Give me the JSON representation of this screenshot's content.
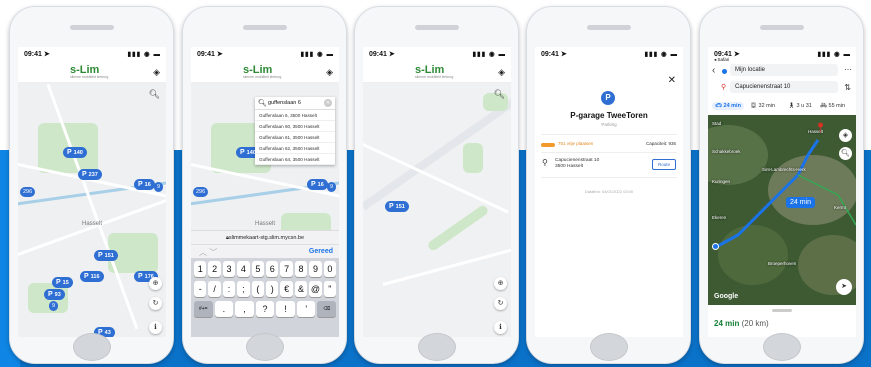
{
  "time": "09:41",
  "brand": {
    "logo": "s-Lim",
    "tagline": "slimme mobiliteit limburg",
    "accent": "#2f6fd3",
    "green": "#2d8a34",
    "blue_bg": "#0b72c9"
  },
  "screen1": {
    "map_label": "Hasselt",
    "pins": [
      "140",
      "237",
      "16",
      "151",
      "116",
      "176",
      "15",
      "93",
      "43"
    ],
    "cluster_labels": [
      "296",
      "9",
      "9"
    ]
  },
  "screen2": {
    "search_value": "guffenslaan 6",
    "suggestions": [
      "Guffenslaan 6, 3500 Hasselt",
      "Guffenslaan 60, 3500 Hasselt",
      "Guffenslaan 61, 3500 Hasselt",
      "Guffenslaan 62, 3500 Hasselt",
      "Guffenslaan 64, 3500 Hasselt"
    ],
    "map_label": "Hasselt",
    "pins": [
      "140",
      "16",
      "9"
    ],
    "cluster_labels": [
      "296"
    ],
    "url": "slimmekaart-stg.slim.mycsn.be",
    "done": "Gereed",
    "keys_row1": [
      "1",
      "2",
      "3",
      "4",
      "5",
      "6",
      "7",
      "8",
      "9",
      "0"
    ],
    "keys_row2": [
      "-",
      "/",
      ":",
      ";",
      "(",
      ")",
      "€",
      "&",
      "@",
      "\""
    ],
    "keys_row3": [
      "#+=",
      ".",
      ",",
      "?",
      "!",
      "'",
      "⌫"
    ]
  },
  "screen3": {
    "pin": "151"
  },
  "screen4": {
    "title": "P-garage TweeToren",
    "subtitle": "Parking",
    "free": "751 vrije plaatsen",
    "capacity": "Capaciteit: 936",
    "address_line1": "Capucienenstraat 10",
    "address_line2": "3500 Hasselt",
    "route_button": "Route",
    "updated": "Datafirst: 04/01/2022 03:00"
  },
  "screen5": {
    "back_app": "Safari",
    "from": "Mijn locatie",
    "to": "Capucienenstraat 10",
    "modes": [
      "24 min",
      "32 min",
      "3 u 31",
      "55 min"
    ],
    "route_time": "24 min",
    "eta": "24 min",
    "distance": "(20 km)",
    "map_labels": [
      "Stad",
      "Schakkebroek",
      "Sint-Lambrechts-Herk",
      "Kuringen",
      "Kermt",
      "Ekeren",
      "Broeperhoven",
      "Hasselt"
    ],
    "google": "Google"
  }
}
